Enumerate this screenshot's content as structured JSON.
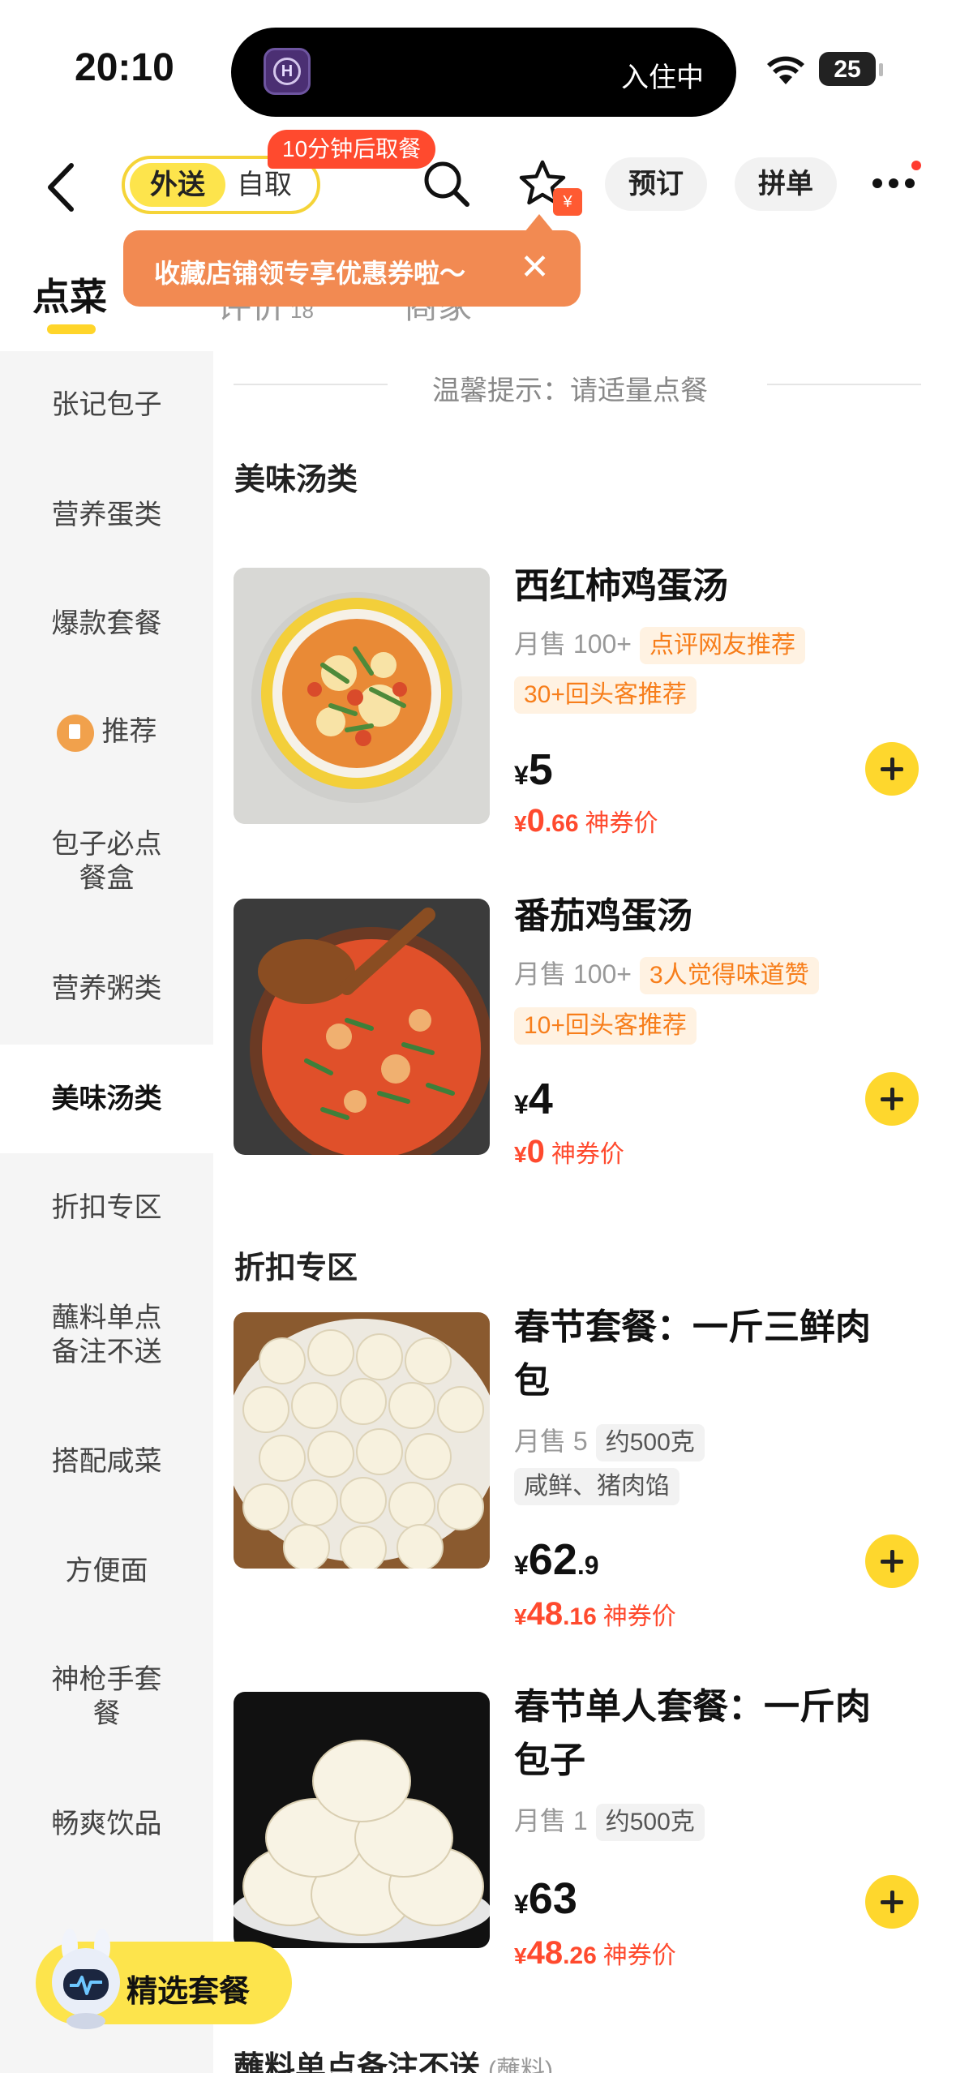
{
  "status_bar": {
    "time": "20:10",
    "live_activity": "入住中",
    "battery": "25"
  },
  "nav": {
    "mode_delivery": "外送",
    "mode_pickup": "自取",
    "pickup_badge": "10分钟后取餐",
    "reserve": "预订",
    "group_order": "拼单"
  },
  "tabs": {
    "order": "点菜",
    "reviews": "评价",
    "reviews_count": "18",
    "merchant": "商家"
  },
  "tooltip": {
    "text": "收藏店铺领专享优惠券啦～",
    "close": "✕"
  },
  "sidebar": {
    "items": [
      "张记包子",
      "营养蛋类",
      "爆款套餐",
      "推荐",
      "包子必点\n餐盒",
      "营养粥类",
      "美味汤类",
      "折扣专区",
      "蘸料单点\n备注不送",
      "搭配咸菜",
      "方便面",
      "神枪手套\n餐",
      "畅爽饮品"
    ]
  },
  "tip": "温馨提示：请适量点餐",
  "sections": {
    "soup": "美味汤类",
    "discount": "折扣专区",
    "next": "蘸料单点备注不送",
    "next_note": "(蘸料)"
  },
  "dishes": [
    {
      "name": "西红柿鸡蛋汤",
      "sales": "月售 100+",
      "tag1": "点评网友推荐",
      "tag2": "30+回头客推荐",
      "price_int": "5",
      "price_dec": "",
      "deal_int": "0",
      "deal_dec": ".66",
      "deal_label": "神券价"
    },
    {
      "name": "番茄鸡蛋汤",
      "sales": "月售 100+",
      "tag1": "3人觉得味道赞",
      "tag2": "10+回头客推荐",
      "price_int": "4",
      "price_dec": "",
      "deal_int": "0",
      "deal_dec": "",
      "deal_label": "神券价"
    },
    {
      "name_l1": "春节套餐：一斤三鲜肉",
      "name_l2": "包",
      "sales": "月售 5",
      "tag1": "约500克",
      "tag2": "咸鲜、猪肉馅",
      "price_int": "62",
      "price_dec": ".9",
      "deal_int": "48",
      "deal_dec": ".16",
      "deal_label": "神券价"
    },
    {
      "name_l1": "春节单人套餐：一斤肉",
      "name_l2": "包子",
      "sales": "月售 1",
      "tag1": "约500克",
      "price_int": "63",
      "price_dec": "",
      "deal_int": "48",
      "deal_dec": ".26",
      "deal_label": "神券价"
    }
  ],
  "currency": "¥",
  "float_button": "精选套餐",
  "colors": {
    "brand_yellow": "#fed72d",
    "deal_red": "#ff4a2e",
    "tag_orange": "#f77e1b"
  }
}
